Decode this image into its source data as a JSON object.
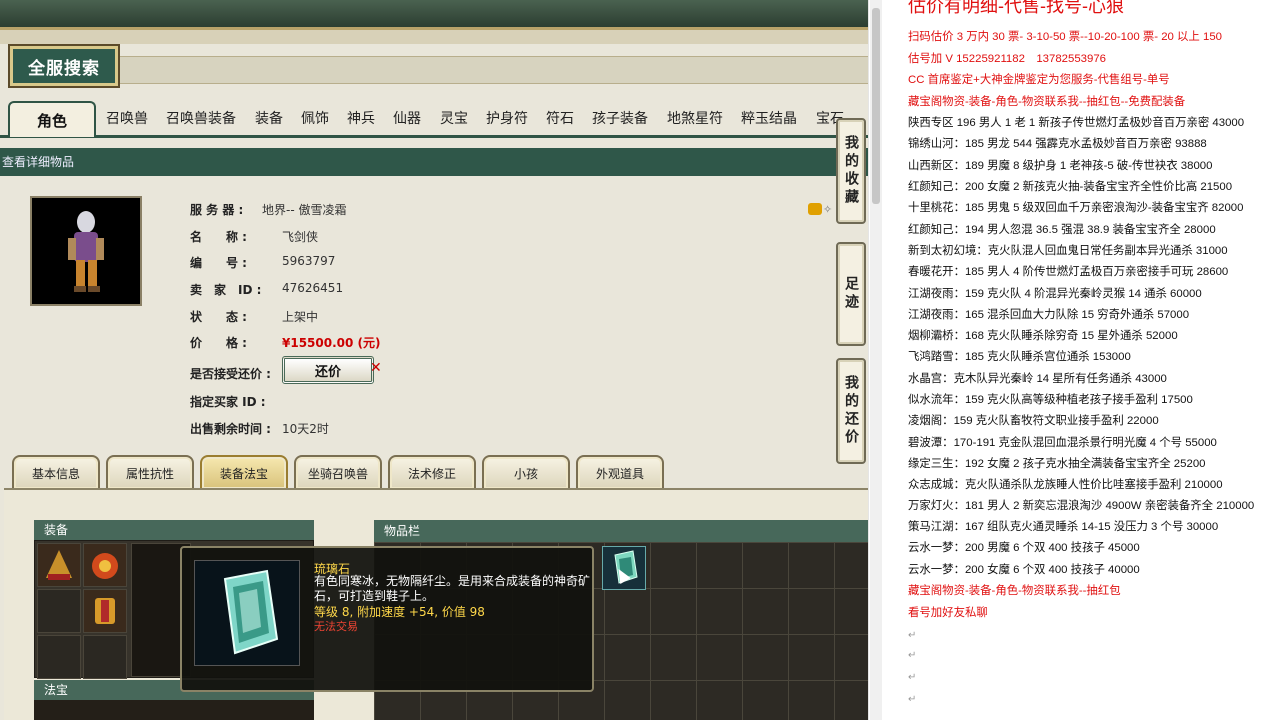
{
  "game": {
    "full_search": "全服搜索",
    "categories": [
      "角色",
      "召唤兽",
      "召唤兽装备",
      "装备",
      "佩饰",
      "神兵",
      "仙器",
      "灵宝",
      "护身符",
      "符石",
      "孩子装备",
      "地煞星符",
      "粹玉结晶",
      "宝石"
    ],
    "detail_title": "查看详细物品",
    "labels": {
      "server": "服 务 器 :",
      "name": "名　　称 :",
      "number": "编　　号 :",
      "seller": "卖　家　ID :",
      "status": "状　　态 :",
      "price": "价　　格 :",
      "accept": "是否接受还价 :",
      "buyer": "指定买家 ID :",
      "remaining": "出售剩余时间 :"
    },
    "values": {
      "server": "地界-- 傲雪凌霜",
      "name": "飞剑侠",
      "number": "5963797",
      "seller": "47626451",
      "status": "上架中",
      "price": "¥15500.00 (元)",
      "remaining": "10天2时"
    },
    "counter_button": "还价",
    "side_buttons": [
      "我的收藏",
      "足迹",
      "我的还价"
    ],
    "subtabs": [
      "基本信息",
      "属性抗性",
      "装备法宝",
      "坐骑召唤兽",
      "法术修正",
      "小孩",
      "外观道具"
    ],
    "equip_header": "装备",
    "fabao_header": "法宝",
    "inventory_header": "物品栏",
    "tooltip": {
      "name": "琉璃石",
      "desc": "有色同寒冰，无物隔纤尘。是用来合成装备的神奇矿石，可打造到鞋子上。",
      "stats": "等级 8, 附加速度 +54, 价值 98",
      "trade": "无法交易"
    }
  },
  "doc": {
    "title": "估价有明细-代售-找号-心狼",
    "lines": [
      {
        "t": "扫码估价 3 万内 30 票- 3-10-50 票--10-20-100 票- 20 以上 150",
        "red": true
      },
      {
        "t": "估号加 V 15225921182　13782553976",
        "red": true
      },
      {
        "t": "CC 首席鉴定+大神金牌鉴定为您服务-代售组号-单号",
        "red": true
      },
      {
        "t": "藏宝阁物资-装备-角色-物资联系我--抽红包--免费配装备",
        "red": true
      },
      {
        "t": "陕西专区 196 男人 1 老 1 新孩子传世燃灯孟极妙音百万亲密 43000",
        "red": false
      },
      {
        "t": "锦绣山河：185 男龙 544 强霹克水孟极妙音百万亲密 93888",
        "red": false
      },
      {
        "t": "山西新区：189 男魔 8 级护身 1 老神孩-5 破-传世袂衣 38000",
        "red": false
      },
      {
        "t": "红颜知己：200 女魔 2 新孩克火抽-装备宝宝齐全性价比高 21500",
        "red": false
      },
      {
        "t": "十里桃花：185 男鬼 5 级双回血千万亲密浪淘沙-装备宝宝齐 82000",
        "red": false
      },
      {
        "t": "红颜知己：194 男人忽混 36.5 强混 38.9 装备宝宝齐全 28000",
        "red": false
      },
      {
        "t": "新到太初幻境：克火队混人回血鬼日常任务副本异光通杀 31000",
        "red": false
      },
      {
        "t": "春暖花开：185 男人 4 阶传世燃灯孟极百万亲密接手可玩 28600",
        "red": false
      },
      {
        "t": "江湖夜雨：159 克火队 4 阶混异光秦岭灵猴 14 通杀 60000",
        "red": false
      },
      {
        "t": "江湖夜雨：165 混杀回血大力队除 15 穷奇外通杀 57000",
        "red": false
      },
      {
        "t": "烟柳灞桥：168 克火队睡杀除穷奇 15 星外通杀 52000",
        "red": false
      },
      {
        "t": "飞鸿踏雪：185 克火队睡杀宫位通杀 153000",
        "red": false
      },
      {
        "t": "水晶宫：克木队异光秦岭 14 星所有任务通杀 43000",
        "red": false
      },
      {
        "t": "似水流年：159 克火队高等级种植老孩子接手盈利 17500",
        "red": false
      },
      {
        "t": "凌烟阁：159 克火队畜牧符文职业接手盈利 22000",
        "red": false
      },
      {
        "t": "碧波潭：170-191 克金队混回血混杀景行明光魔 4 个号 55000",
        "red": false
      },
      {
        "t": "缘定三生：192 女魔 2 孩子克水抽全满装备宝宝齐全 25200",
        "red": false
      },
      {
        "t": "众志成城：克火队通杀队龙族睡人性价比哇塞接手盈利 210000",
        "red": false
      },
      {
        "t": "万家灯火：181 男人 2 新奕忘混浪淘沙 4900W 亲密装备齐全 210000",
        "red": false
      },
      {
        "t": "策马江湖：167 组队克火通灵睡杀 14-15 没压力 3 个号 30000",
        "red": false
      },
      {
        "t": "云水一梦：200 男魔 6 个双 400 技孩子 45000",
        "red": false
      },
      {
        "t": "云水一梦：200 女魔 6 个双 400 技孩子 40000",
        "red": false
      },
      {
        "t": "藏宝阁物资-装备-角色-物资联系我--抽红包",
        "red": true
      },
      {
        "t": "看号加好友私聊",
        "red": true
      }
    ]
  },
  "colors": {
    "accent": "#2f5749",
    "price": "#cc0000",
    "doc_red": "#e01010"
  }
}
